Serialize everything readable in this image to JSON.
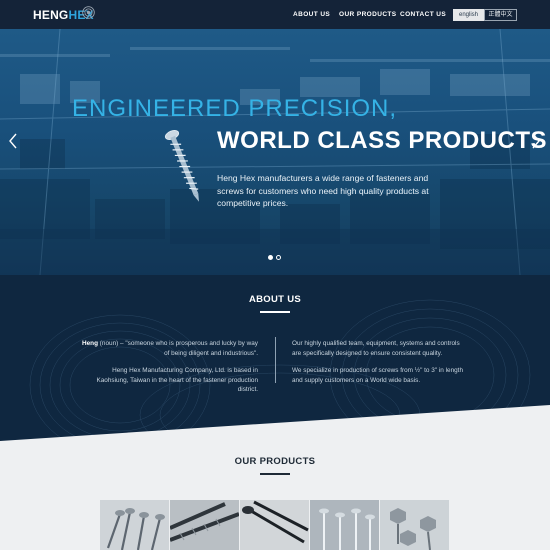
{
  "brand": {
    "name_part1": "HENG",
    "name_part2": "HEX"
  },
  "nav": {
    "items": [
      {
        "label": "ABOUT US"
      },
      {
        "label": "OUR PRODUCTS"
      },
      {
        "label": "CONTACT US"
      }
    ],
    "languages": [
      {
        "label": "english",
        "active": true
      },
      {
        "label": "正體中文",
        "active": false
      }
    ]
  },
  "hero": {
    "headline_line1": "ENGINEERED PRECISION,",
    "headline_line2": "WORLD CLASS PRODUCTS",
    "description": "Heng Hex manufacturers a wide range of fasteners and screws for customers who need high quality products at competitive prices.",
    "slides": [
      {
        "active": true
      },
      {
        "active": false
      }
    ]
  },
  "about": {
    "title": "ABOUT US",
    "left": {
      "def_term": "Heng",
      "def_text": " (noun) – \"someone who is prosperous and lucky by way of being diligent and industrious\".",
      "para2": "Heng Hex Manufacturing Company, Ltd. is based in Kaohsiung, Taiwan in the heart of the fastener production district."
    },
    "right": {
      "para1": "Our highly qualified team, equipment, systems and controls are specifically designed to ensure consistent quality.",
      "para2": "We specialize in production of screws from ½\" to 3\" in length and supply customers on a World wide basis."
    }
  },
  "products": {
    "title": "OUR PRODUCTS",
    "thumbnails": 5
  },
  "colors": {
    "nav_bg": "#142338",
    "accent_blue": "#35b3e6",
    "hero_blue": "#19507c",
    "about_bg": "#0f2740",
    "page_bg": "#eef0f2"
  }
}
